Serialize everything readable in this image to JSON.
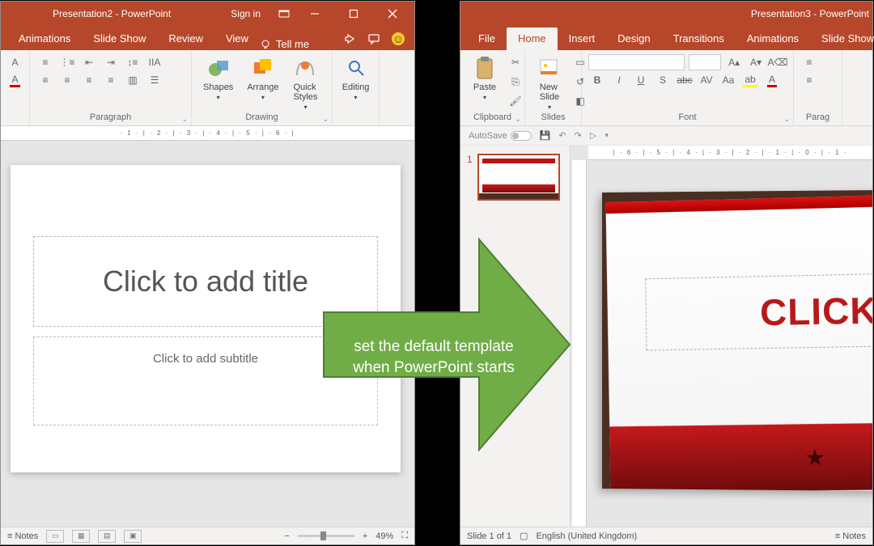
{
  "left": {
    "title": "Presentation2  -  PowerPoint",
    "signin": "Sign in",
    "tabs": {
      "anim": "Animations",
      "show": "Slide Show",
      "review": "Review",
      "view": "View",
      "tellme": "Tell me"
    },
    "groups": {
      "paragraph": "Paragraph",
      "drawing": "Drawing",
      "editing": "Editing"
    },
    "big": {
      "shapes": "Shapes",
      "arrange": "Arrange",
      "quick": "Quick\nStyles",
      "editing": "Editing"
    },
    "slide": {
      "title": "Click to add title",
      "subtitle": "Click to add subtitle"
    },
    "ruler": "· 1 · | · 2 · | · 3 · | · 4 · | · 5 · | · 6 · |",
    "status": {
      "notes": "Notes",
      "zoom": "49%"
    }
  },
  "right": {
    "title": "Presentation3  -  PowerPoint",
    "tabs": {
      "file": "File",
      "home": "Home",
      "insert": "Insert",
      "design": "Design",
      "trans": "Transitions",
      "anim": "Animations",
      "show": "Slide Show"
    },
    "groups": {
      "clipboard": "Clipboard",
      "slides": "Slides",
      "font": "Font",
      "paragraph": "Parag"
    },
    "big": {
      "paste": "Paste",
      "newslide": "New\nSlide"
    },
    "autosave": "AutoSave",
    "thumbnum": "1",
    "ruler": "| · 6 · | · 5 · | · 4 · | · 3 · | · 2 · | · 1 · | · 0 · | · 1 ·",
    "bigtitle": "CLICK T",
    "status": {
      "slide": "Slide 1 of 1",
      "lang": "English (United Kingdom)",
      "notes": "Notes"
    }
  },
  "arrow": "set the default template when PowerPoint starts"
}
